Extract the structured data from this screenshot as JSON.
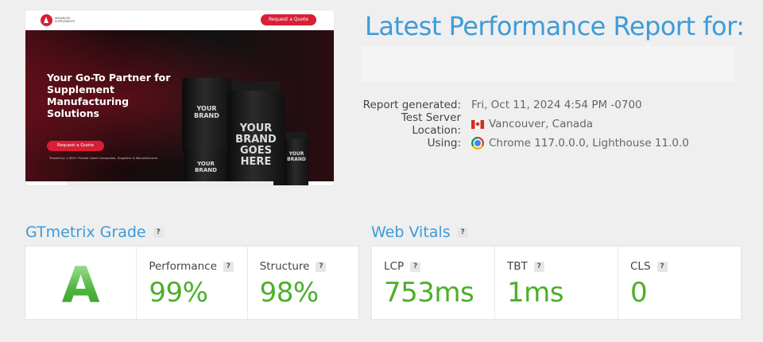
{
  "preview": {
    "header_cta": "Request a Quote",
    "headline": "Your Go-To Partner for Supplement Manufacturing Solutions",
    "hero_button": "Request a Quote",
    "trust_line": "Trusted by 1,000+ Private Label Companies, Suppliers & Manufacturers",
    "logo_text": "ADVANCED SUPPLEMENTS",
    "products": {
      "pouch": "YOUR BRAND",
      "big_jar": "YOUR BRAND GOES HERE",
      "small_jar": "YOUR BRAND",
      "bottle": "YOUR BRAND"
    }
  },
  "report": {
    "title": "Latest Performance Report for:",
    "generated_label": "Report generated:",
    "generated_value": "Fri, Oct 11, 2024 4:54 PM -0700",
    "location_label": "Test Server Location:",
    "location_value": "Vancouver, Canada",
    "location_icon": "canada-flag-icon",
    "using_label": "Using:",
    "using_value": "Chrome 117.0.0.0, Lighthouse 11.0.0",
    "using_icon": "chrome-icon"
  },
  "grade": {
    "title": "GTmetrix Grade",
    "help": "?",
    "letter": "A",
    "performance_label": "Performance",
    "performance_value": "99%",
    "structure_label": "Structure",
    "structure_value": "98%"
  },
  "vitals": {
    "title": "Web Vitals",
    "help": "?",
    "lcp_label": "LCP",
    "lcp_value": "753ms",
    "tbt_label": "TBT",
    "tbt_value": "1ms",
    "cls_label": "CLS",
    "cls_value": "0"
  },
  "colors": {
    "accent_blue": "#3d9bd8",
    "good_green": "#4caf2a",
    "brand_red": "#d81f35"
  }
}
